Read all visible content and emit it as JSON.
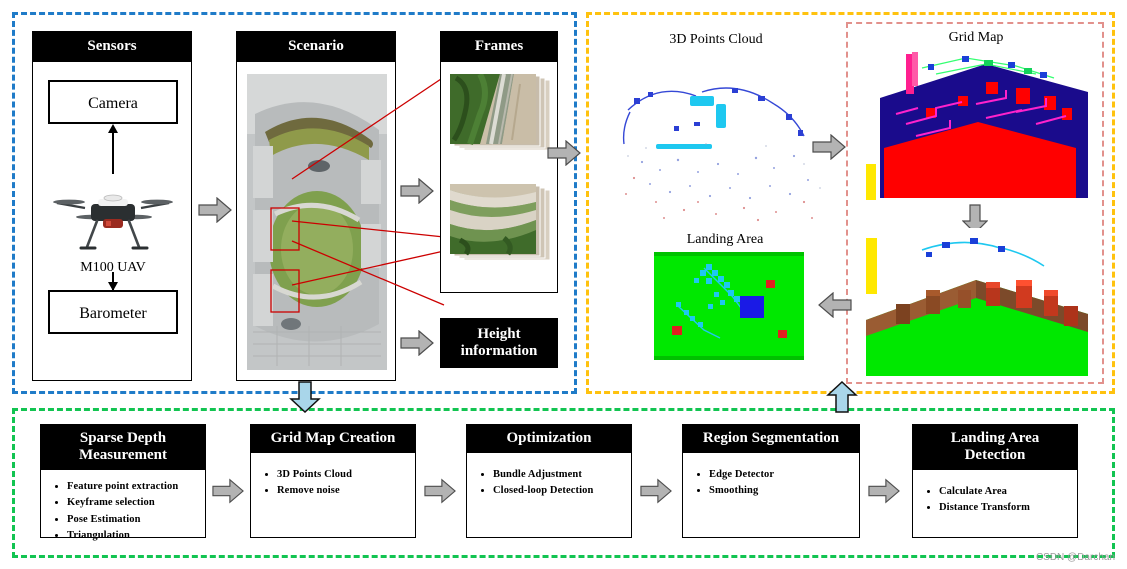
{
  "regions": {
    "acquisition": {
      "name": "data-acquisition-region",
      "color": "#1f7bc8"
    },
    "mapping": {
      "name": "mapping-region",
      "color": "#ffc20e"
    },
    "gridmap": {
      "name": "grid-map-region",
      "color": "#e2918c"
    },
    "pipeline": {
      "name": "pipeline-region",
      "color": "#12c451"
    }
  },
  "sensors": {
    "title": "Sensors",
    "camera": "Camera",
    "barometer": "Barometer",
    "uav_label": "M100 UAV"
  },
  "scenario": {
    "title": "Scenario"
  },
  "frames": {
    "title": "Frames"
  },
  "height_info": {
    "label": "Height\ninformation"
  },
  "mapping": {
    "point_cloud_title": "3D Points Cloud",
    "grid_map_title": "Grid Map",
    "landing_area_title": "Landing Area"
  },
  "pipeline": {
    "steps": [
      {
        "title": "Sparse Depth\nMeasurement",
        "items": [
          "Feature point extraction",
          "Keyframe selection",
          "Pose Estimation",
          "Triangulation"
        ]
      },
      {
        "title": "Grid  Map Creation",
        "items": [
          "3D Points Cloud",
          "Remove noise"
        ]
      },
      {
        "title": "Optimization",
        "items": [
          "Bundle Adjustment",
          "Closed-loop Detection"
        ]
      },
      {
        "title": "Region Segmentation",
        "items": [
          "Edge Detector",
          "Smoothing"
        ]
      },
      {
        "title": "Landing Area\nDetection",
        "items": [
          "Calculate Area",
          "Distance Transform"
        ]
      }
    ]
  },
  "watermark": "CSDN @Darchan"
}
